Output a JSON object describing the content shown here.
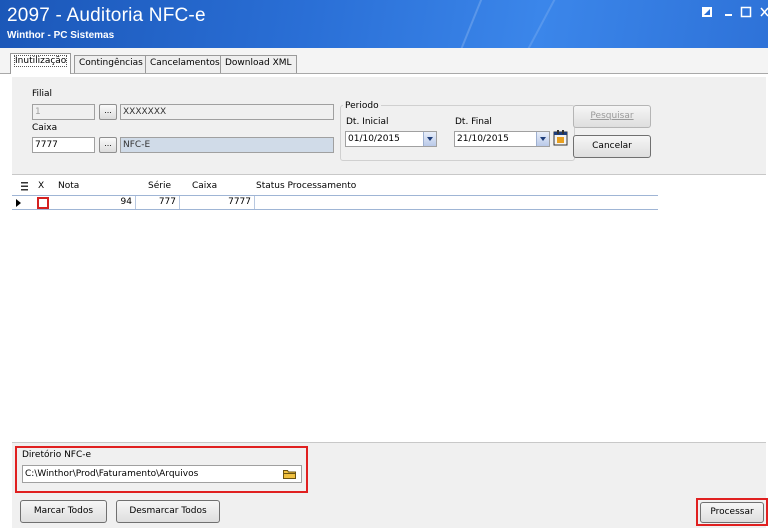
{
  "window": {
    "title": "2097 - Auditoria NFC-e",
    "subtitle": "Winthor - PC Sistemas"
  },
  "tabs": [
    {
      "label": "Inutilização",
      "active": true
    },
    {
      "label": "Contingências",
      "active": false
    },
    {
      "label": "Cancelamentos",
      "active": false
    },
    {
      "label": "Download XML",
      "active": false
    }
  ],
  "filters": {
    "filial": {
      "label": "Filial",
      "code": "1",
      "name": "XXXXXXX"
    },
    "caixa": {
      "label": "Caixa",
      "code": "7777",
      "name": "NFC-E"
    },
    "ellipsis": "...",
    "periodo": {
      "label": "Periodo",
      "dt_inicial_label": "Dt. Inicial",
      "dt_inicial": "01/10/2015",
      "dt_final_label": "Dt. Final",
      "dt_final": "21/10/2015"
    },
    "pesquisar_label": "Pesquisar",
    "cancelar_label": "Cancelar"
  },
  "grid": {
    "columns": [
      "X",
      "Nota",
      "Série",
      "Caixa",
      "Status Processamento"
    ],
    "rows": [
      {
        "nota": "94",
        "serie": "777",
        "caixa": "7777",
        "status": ""
      }
    ]
  },
  "directory": {
    "label": "Diretório NFC-e",
    "path": "C:\\Winthor\\Prod\\Faturamento\\Arquivos"
  },
  "actions": {
    "marcar_todos": "Marcar Todos",
    "desmarcar_todos": "Desmarcar Todos",
    "processar": "Processar"
  },
  "colors": {
    "titlebar": "#2a6fd6",
    "highlight": "#e02020"
  }
}
